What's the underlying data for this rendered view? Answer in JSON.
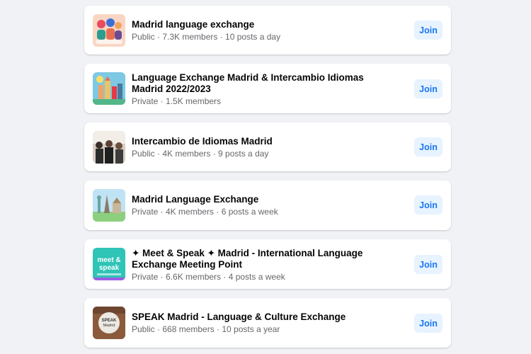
{
  "groups": [
    {
      "title": "Madrid language exchange",
      "meta": "Public · 7.3K members · 10 posts a day",
      "join_label": "Join",
      "thumb_icon": "illustrated-people-thumbnail"
    },
    {
      "title": "Language Exchange Madrid & Intercambio Idiomas Madrid 2022/2023",
      "meta": "Private · 1.5K members",
      "join_label": "Join",
      "thumb_icon": "city-landmarks-thumbnail"
    },
    {
      "title": "Intercambio de Idiomas Madrid",
      "meta": "Public · 4K members · 9 posts a day",
      "join_label": "Join",
      "thumb_icon": "group-photo-thumbnail"
    },
    {
      "title": "Madrid Language Exchange",
      "meta": "Private · 4K members · 6 posts a week",
      "join_label": "Join",
      "thumb_icon": "world-landmarks-thumbnail"
    },
    {
      "title": "✦ Meet & Speak ✦ Madrid - International Language Exchange Meeting Point",
      "meta": "Private · 6.6K members · 4 posts a week",
      "join_label": "Join",
      "thumb_icon": "meet-and-speak-logo-thumbnail",
      "thumb_text_1": "meet &",
      "thumb_text_2": "speak"
    },
    {
      "title": "SPEAK Madrid - Language & Culture Exchange",
      "meta": "Public · 668 members · 10 posts a year",
      "join_label": "Join",
      "thumb_icon": "speak-madrid-logo-thumbnail",
      "thumb_text_1": "SPEAK",
      "thumb_text_2": "Madrid"
    }
  ],
  "colors": {
    "page_background": "#f0f2f5",
    "card_background": "#ffffff",
    "join_background": "#e7f3ff",
    "join_text": "#1877f2",
    "meta_text": "#65676b"
  }
}
